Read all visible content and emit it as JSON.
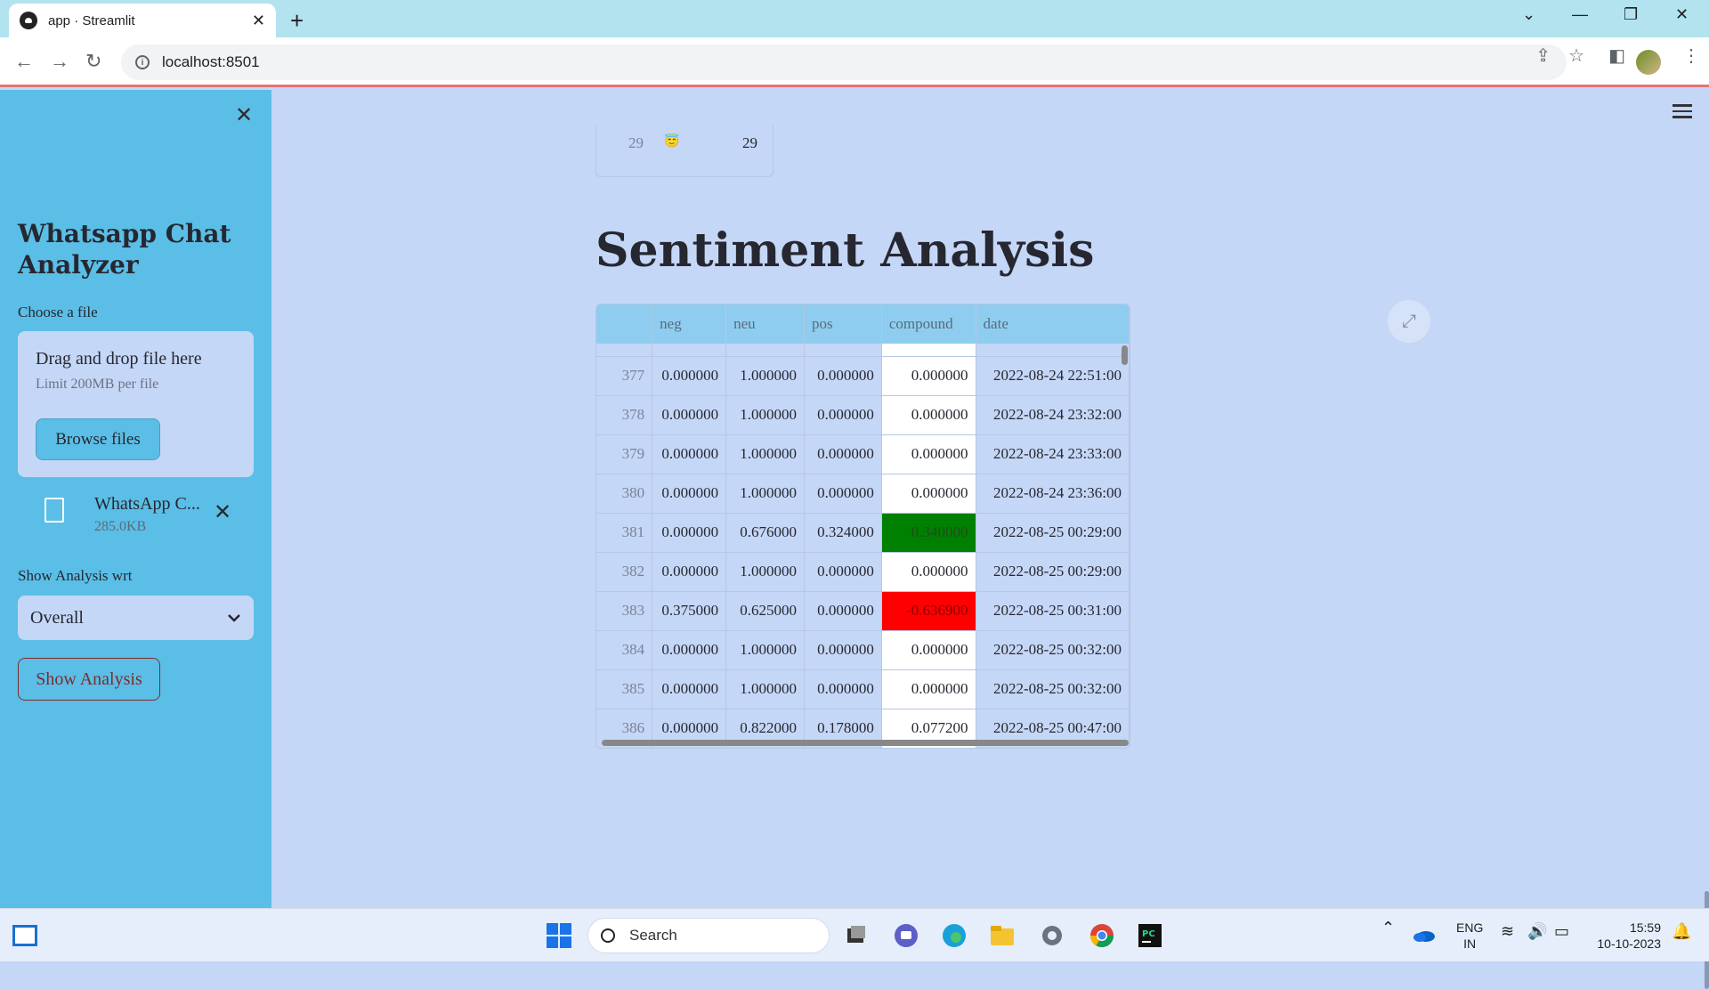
{
  "browser": {
    "tab_title": "app · Streamlit",
    "tab_close": "✕",
    "new_tab": "+",
    "url": "localhost:8501",
    "window_controls": [
      "⌄",
      "—",
      "❐",
      "✕"
    ]
  },
  "sidebar": {
    "close": "✕",
    "title": "Whatsapp Chat Analyzer",
    "file_label": "Choose a file",
    "dropzone_title": "Drag and drop file here",
    "dropzone_limit": "Limit 200MB per file",
    "browse_button": "Browse files",
    "file_name": "WhatsApp C...",
    "file_size": "285.0KB",
    "file_remove": "✕",
    "analysis_label": "Show Analysis wrt",
    "analysis_selected": "Overall",
    "show_button": "Show Analysis"
  },
  "main": {
    "prev_row_index": "29",
    "prev_row_emoji": "😇",
    "prev_row_count": "29",
    "heading": "Sentiment Analysis",
    "expand_icon": "⤢",
    "columns": [
      "",
      "neg",
      "neu",
      "pos",
      "compound",
      "date"
    ],
    "rows": [
      {
        "idx": "377",
        "neg": "0.000000",
        "neu": "1.000000",
        "pos": "0.000000",
        "compound": "0.000000",
        "date": "2022-08-24 22:51:00",
        "tone": "neutral"
      },
      {
        "idx": "378",
        "neg": "0.000000",
        "neu": "1.000000",
        "pos": "0.000000",
        "compound": "0.000000",
        "date": "2022-08-24 23:32:00",
        "tone": "neutral"
      },
      {
        "idx": "379",
        "neg": "0.000000",
        "neu": "1.000000",
        "pos": "0.000000",
        "compound": "0.000000",
        "date": "2022-08-24 23:33:00",
        "tone": "neutral"
      },
      {
        "idx": "380",
        "neg": "0.000000",
        "neu": "1.000000",
        "pos": "0.000000",
        "compound": "0.000000",
        "date": "2022-08-24 23:36:00",
        "tone": "neutral"
      },
      {
        "idx": "381",
        "neg": "0.000000",
        "neu": "0.676000",
        "pos": "0.324000",
        "compound": "0.340000",
        "date": "2022-08-25 00:29:00",
        "tone": "positive"
      },
      {
        "idx": "382",
        "neg": "0.000000",
        "neu": "1.000000",
        "pos": "0.000000",
        "compound": "0.000000",
        "date": "2022-08-25 00:29:00",
        "tone": "neutral"
      },
      {
        "idx": "383",
        "neg": "0.375000",
        "neu": "0.625000",
        "pos": "0.000000",
        "compound": "-0.636900",
        "date": "2022-08-25 00:31:00",
        "tone": "negative"
      },
      {
        "idx": "384",
        "neg": "0.000000",
        "neu": "1.000000",
        "pos": "0.000000",
        "compound": "0.000000",
        "date": "2022-08-25 00:32:00",
        "tone": "neutral"
      },
      {
        "idx": "385",
        "neg": "0.000000",
        "neu": "1.000000",
        "pos": "0.000000",
        "compound": "0.000000",
        "date": "2022-08-25 00:32:00",
        "tone": "neutral"
      },
      {
        "idx": "386",
        "neg": "0.000000",
        "neu": "0.822000",
        "pos": "0.178000",
        "compound": "0.077200",
        "date": "2022-08-25 00:47:00",
        "tone": "neutral"
      }
    ]
  },
  "colors": {
    "positive": "#008000",
    "negative": "#ff0000",
    "sidebar": "#5bbee6",
    "main": "#c5d7f7"
  },
  "taskbar": {
    "search_placeholder": "Search",
    "lang_top": "ENG",
    "lang_bottom": "IN",
    "time": "15:59",
    "date": "10-10-2023"
  }
}
